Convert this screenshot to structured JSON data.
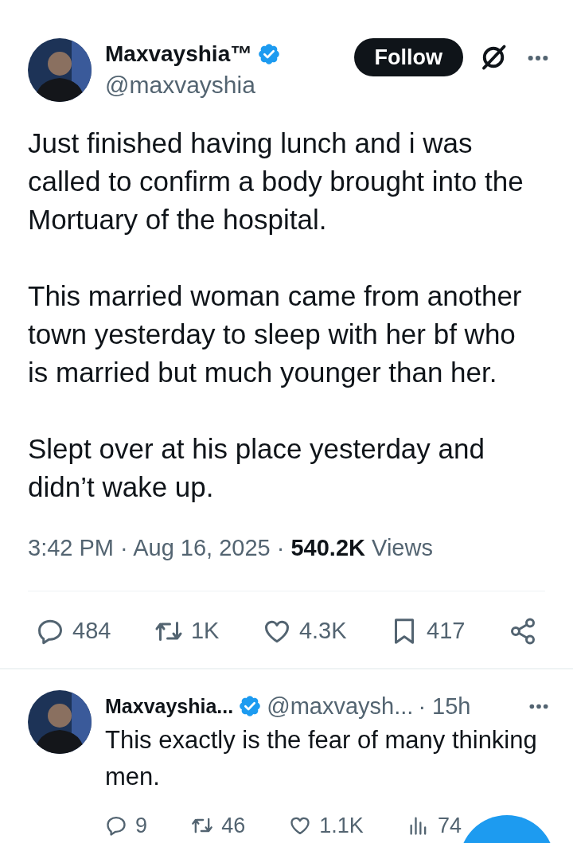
{
  "post": {
    "author": {
      "name": "Maxvayshia™",
      "handle": "@maxvayshia",
      "verified": true
    },
    "follow_button": "Follow",
    "paragraphs": [
      "Just finished having lunch and i was called to confirm a body brought into the Mortuary of the hospital.",
      "This married woman came from another town yesterday to sleep with her bf who is married but much younger than her.",
      "Slept over at his place yesterday and didn’t wake up."
    ],
    "meta": "3:42 PM · Aug 16, 2025 · **540.2K** Views",
    "actions": [
      {
        "kind": "reply",
        "count": "484"
      },
      {
        "kind": "repost",
        "count": "1K"
      },
      {
        "kind": "like",
        "count": "4.3K"
      },
      {
        "kind": "bookmark",
        "count": "417"
      },
      {
        "kind": "share"
      }
    ]
  },
  "reply": {
    "author": {
      "name": "Maxvayshia...",
      "handle": "@maxvaysh...",
      "time": "· 15h",
      "verified": true
    },
    "text": "This exactly is the fear of many thinking men.",
    "actions": [
      {
        "kind": "reply",
        "count": "9"
      },
      {
        "kind": "repost",
        "count": "46"
      },
      {
        "kind": "like",
        "count": "1.1K"
      },
      {
        "kind": "views",
        "count": "74"
      }
    ]
  }
}
